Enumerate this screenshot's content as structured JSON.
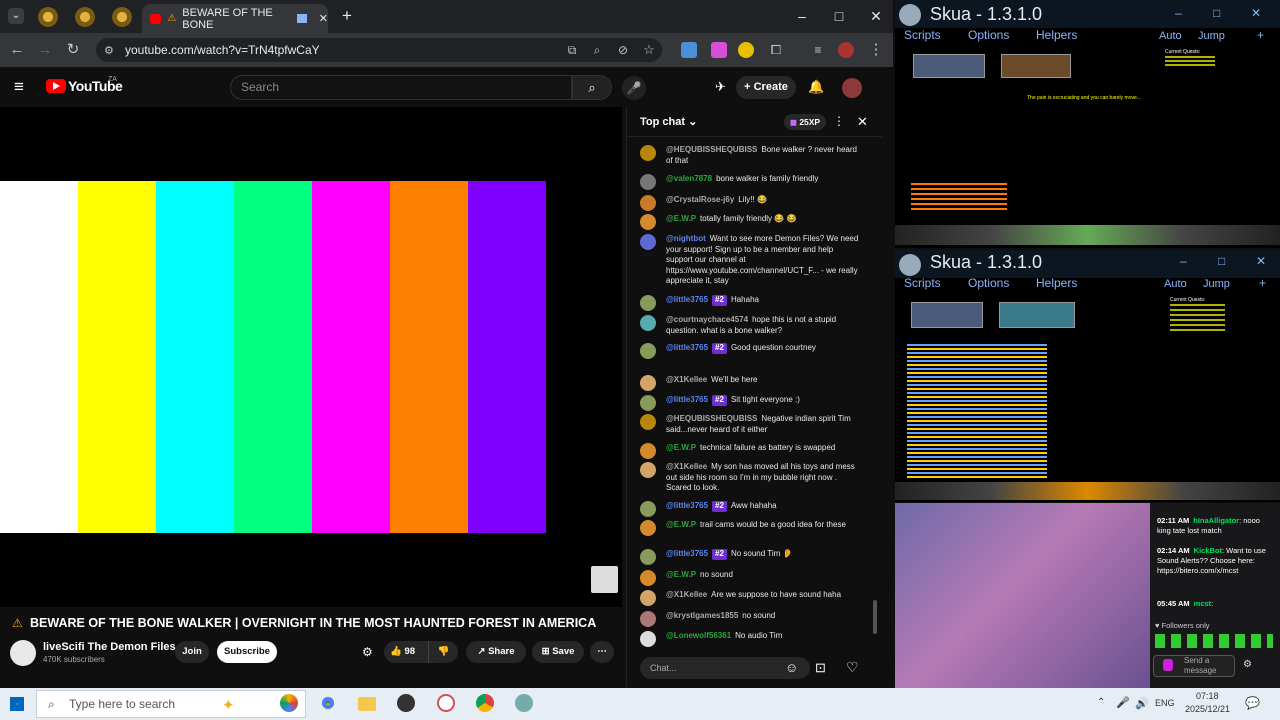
{
  "browser": {
    "active_tab_title": "BEWARE OF THE BONE",
    "url": "youtube.com/watch?v=TrN4tpfwCaY",
    "new_tab": "+",
    "controls": {
      "minimize": "–",
      "maximize": "□",
      "close": "✕"
    }
  },
  "youtube": {
    "logo": "YouTube",
    "region": "ZA",
    "search_placeholder": "Search",
    "create_label": "Create",
    "video_title": "BEWARE OF THE BONE WALKER | OVERNIGHT IN THE MOST HAUNTED FOREST IN AMERICA",
    "channel_name": "liveScifi The Demon Files",
    "subscribers": "470K subscribers",
    "join_label": "Join",
    "subscribe_label": "Subscribe",
    "likes": "98",
    "share_label": "Share",
    "save_label": "Save",
    "color_bars": [
      "#ffffff",
      "#ffff00",
      "#00ffff",
      "#00ff80",
      "#ff00ff",
      "#ff8000",
      "#8000ff"
    ]
  },
  "chat": {
    "header": "Top chat",
    "xp_label": "25XP",
    "input_placeholder": "Chat...",
    "messages": [
      {
        "author": "@HEQUBISSHEQUBISS",
        "text": "Bone walker ? never heard of that",
        "cls": "",
        "av": "#b8860b"
      },
      {
        "author": "@valen7878",
        "text": "bone walker is family friendly",
        "cls": "g",
        "av": "#777"
      },
      {
        "author": "@CrystalRose-j6y",
        "text": "Lily!! 😂",
        "cls": "",
        "av": "#c97b2a"
      },
      {
        "author": "@E.W.P",
        "text": "totally family friendly 😂 😂",
        "cls": "g",
        "av": "#d48a2a"
      },
      {
        "author": "@nightbot",
        "text": "Want to see more Demon Files? We need your support! Sign up to be a member and help support our channel at https://www.youtube.com/channel/UCT_F... - we really appreciate it, stay",
        "cls": "m",
        "av": "#5e6ad2"
      },
      {
        "author": "@little3765",
        "badge": "#2",
        "text": "Hahaha",
        "cls": "m",
        "av": "#8a9a5b"
      },
      {
        "author": "@courtnaychace4574",
        "text": "hope this is not a stupid question. what is a bone walker?",
        "cls": "",
        "av": "#5aa"
      },
      {
        "author": "@little3765",
        "badge": "#2",
        "text": "Good question courtney",
        "cls": "m",
        "av": "#8a9a5b"
      },
      {
        "author": "@X1Kellee",
        "text": "We'll be here",
        "cls": "",
        "av": "#d4a36a"
      },
      {
        "author": "@little3765",
        "badge": "#2",
        "text": "Sit tight everyone :)",
        "cls": "m",
        "av": "#8a9a5b"
      },
      {
        "author": "@HEQUBISSHEQUBISS",
        "text": "Negative indian spirit Tim said...never heard of it either",
        "cls": "",
        "av": "#b8860b"
      },
      {
        "author": "@E.W.P",
        "text": "technical failure as battery is swapped",
        "cls": "g",
        "av": "#d48a2a"
      },
      {
        "author": "@X1Kellee",
        "text": "My son has moved all his toys and mess out side his room so I'm in my bubble right now . Scared to look.",
        "cls": "",
        "av": "#d4a36a"
      },
      {
        "author": "@little3765",
        "badge": "#2",
        "text": "Aww hahaha",
        "cls": "m",
        "av": "#8a9a5b"
      },
      {
        "author": "@E.W.P",
        "text": "trail cams would be a good idea for these",
        "cls": "g",
        "av": "#d48a2a"
      },
      {
        "author": "@little3765",
        "badge": "#2",
        "text": "No sound Tim 👂",
        "cls": "m",
        "av": "#8a9a5b"
      },
      {
        "author": "@E.W.P",
        "text": "no sound",
        "cls": "g",
        "av": "#d48a2a"
      },
      {
        "author": "@X1Kellee",
        "text": "Are we suppose to have sound haha",
        "cls": "",
        "av": "#d4a36a"
      },
      {
        "author": "@krystlgames1855",
        "text": "no sound",
        "cls": "",
        "av": "#a77"
      },
      {
        "author": "@Lonewolf56361",
        "text": "No audio Tim",
        "cls": "g",
        "av": "#ddd"
      }
    ]
  },
  "skua": [
    {
      "title": "Skua - 1.3.1.0",
      "menu": [
        "Scripts",
        "Options",
        "Helpers"
      ],
      "right": [
        "Auto",
        "Jump"
      ],
      "quest": "Current Quests:",
      "banner": "The pain is excruciating and you can barely move..."
    },
    {
      "title": "Skua - 1.3.1.0",
      "menu": [
        "Scripts",
        "Options",
        "Helpers"
      ],
      "right": [
        "Auto",
        "Jump"
      ],
      "quest": "Current Quests:"
    }
  ],
  "stream_chat": {
    "lines": [
      {
        "time": "02:11 AM",
        "user": "hInaAlligator",
        "text": "nooo king tate lost match"
      },
      {
        "time": "02:14 AM",
        "user": "KickBot",
        "text": "Want to use Sound Alerts?? Choose here: https://bitero.com/x/mcst"
      },
      {
        "time": "05:45 AM",
        "user": "mcst",
        "text": ""
      }
    ],
    "followers": "Followers only",
    "send_placeholder": "Send a message"
  },
  "taskbar": {
    "search_placeholder": "Type here to search",
    "language": "ENG",
    "time": "07:18",
    "date": "2025/12/21"
  }
}
